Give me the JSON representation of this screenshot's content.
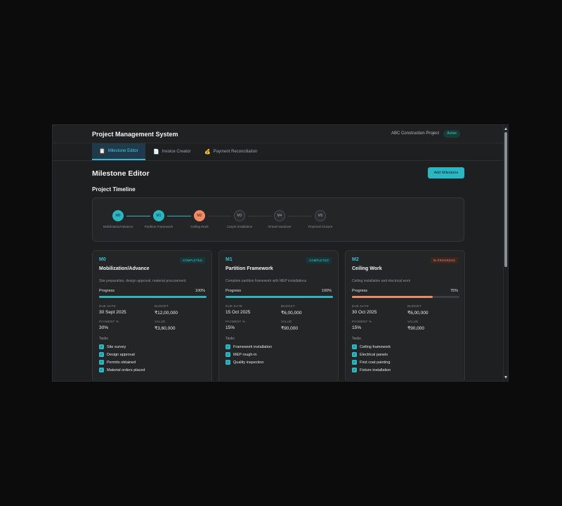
{
  "header": {
    "title": "Project Management System",
    "project": "ABC Construction Project",
    "status_badge": "Active"
  },
  "tabs": [
    {
      "label": "Milestone Editor",
      "icon": "document-icon",
      "active": true
    },
    {
      "label": "Invoice Creator",
      "icon": "file-icon",
      "active": false
    },
    {
      "label": "Payment Reconciliation",
      "icon": "money-bag-icon",
      "active": false
    }
  ],
  "page": {
    "title": "Milestone Editor",
    "add_button": "Add Milestone",
    "timeline_title": "Project Timeline"
  },
  "timeline": [
    {
      "code": "M0",
      "label": "Mobilization/Advance",
      "state": "done"
    },
    {
      "code": "M1",
      "label": "Partition Framework",
      "state": "done"
    },
    {
      "code": "M2",
      "label": "Ceiling Work",
      "state": "current"
    },
    {
      "code": "M3",
      "label": "Carpet Installation",
      "state": "pending"
    },
    {
      "code": "M4",
      "label": "Virtual Handover",
      "state": "pending"
    },
    {
      "code": "M5",
      "label": "Financial Closure",
      "state": "pending"
    }
  ],
  "colors": {
    "accent": "#2ab7c4",
    "in_progress": "#f08a66",
    "pending": "#2a2d30"
  },
  "cards": [
    {
      "code": "M0",
      "status": "COMPLETED",
      "status_type": "completed",
      "name": "Mobilization/Advance",
      "description": "Site preparation, design approval, material procurement",
      "progress_label": "Progress",
      "progress_text": "100%",
      "progress": 100,
      "due_label": "DUE DATE",
      "due": "30 Sept 2025",
      "budget_label": "BUDGET",
      "budget": "₹12,00,000",
      "payment_label": "PAYMENT %",
      "payment": "30%",
      "value_label": "VALUE",
      "value": "₹3,60,000",
      "tasks_label": "Tasks",
      "tasks": [
        "Site survey",
        "Design approval",
        "Permits obtained",
        "Material orders placed"
      ]
    },
    {
      "code": "M1",
      "status": "COMPLETED",
      "status_type": "completed",
      "name": "Partition Framework",
      "description": "Complete partition framework with MEP installations",
      "progress_label": "Progress",
      "progress_text": "100%",
      "progress": 100,
      "due_label": "DUE DATE",
      "due": "15 Oct 2025",
      "budget_label": "BUDGET",
      "budget": "₹6,00,000",
      "payment_label": "PAYMENT %",
      "payment": "15%",
      "value_label": "VALUE",
      "value": "₹90,000",
      "tasks_label": "Tasks",
      "tasks": [
        "Framework installation",
        "MEP rough-in",
        "Quality inspection"
      ]
    },
    {
      "code": "M2",
      "status": "IN PROGRESS",
      "status_type": "progress",
      "name": "Ceiling Work",
      "description": "Ceiling installation and electrical work",
      "progress_label": "Progress",
      "progress_text": "75%",
      "progress": 75,
      "due_label": "DUE DATE",
      "due": "30 Oct 2025",
      "budget_label": "BUDGET",
      "budget": "₹6,00,000",
      "payment_label": "PAYMENT %",
      "payment": "15%",
      "value_label": "VALUE",
      "value": "₹90,000",
      "tasks_label": "Tasks",
      "tasks": [
        "Ceiling framework",
        "Electrical panels",
        "First coat painting",
        "Fixture installation"
      ]
    }
  ]
}
